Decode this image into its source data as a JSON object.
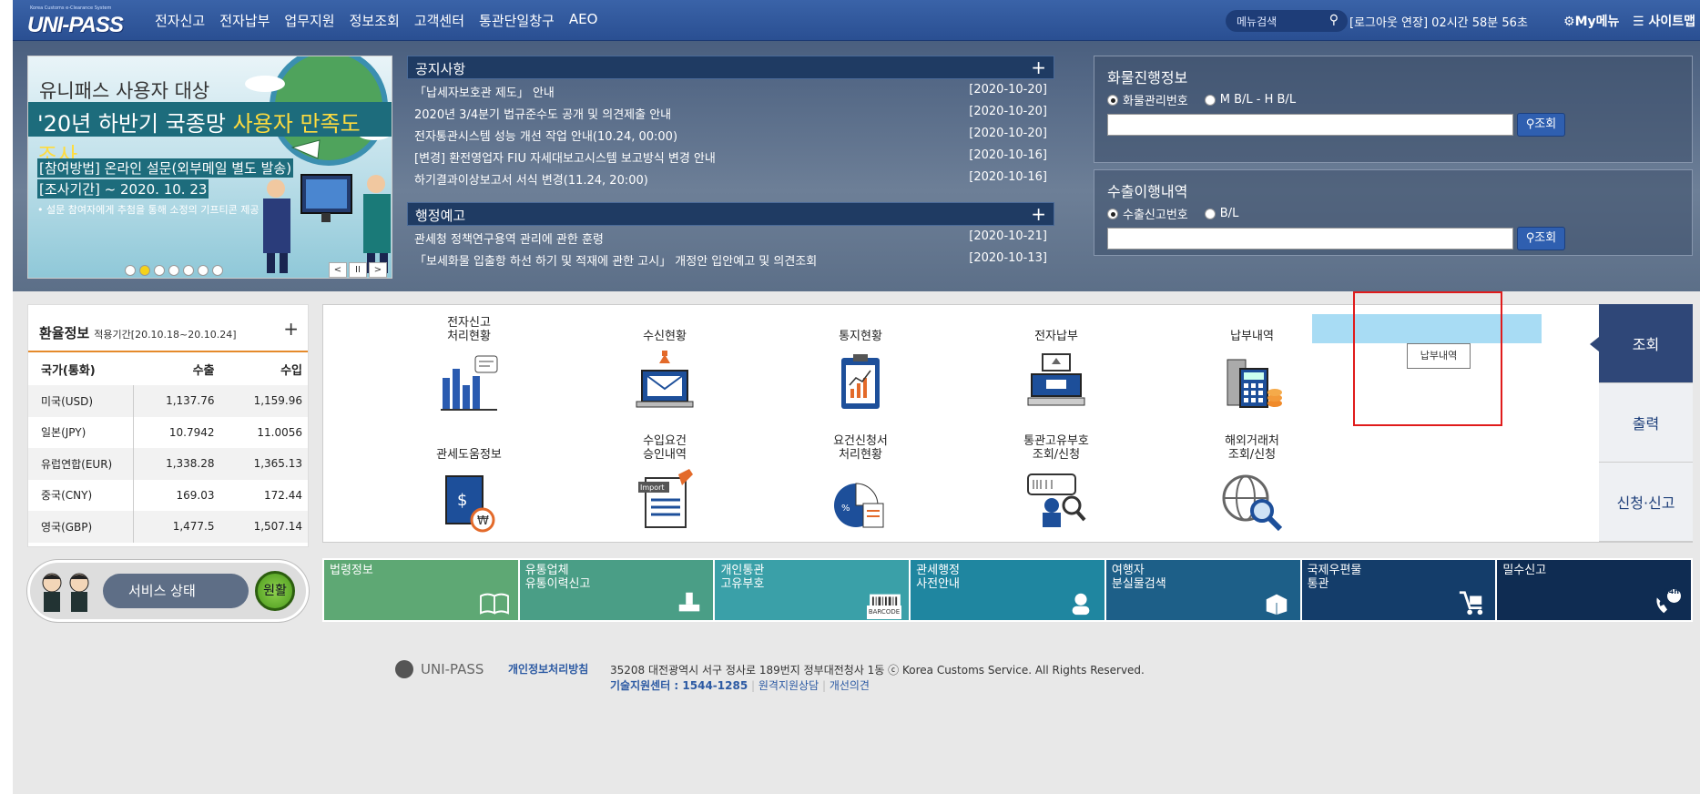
{
  "brand": {
    "logo_small": "Korea Customs e-Clearance System",
    "logo_text": "UNI-PASS"
  },
  "gnb": [
    "전자신고",
    "전자납부",
    "업무지원",
    "정보조회",
    "고객센터",
    "통관단일창구",
    "AEO"
  ],
  "search": {
    "placeholder": "메뉴검색"
  },
  "session": {
    "text": "[로그아웃 연장] 02시간 58분 56초"
  },
  "my_menu": "My메뉴",
  "sitemap": "사이트맵",
  "banner": {
    "line1": "유니패스 사용자 대상",
    "line2_a": "'20년 하반기 국종망 ",
    "line2_b": "사용자 만족도 조사",
    "method": "[참여방법]  온라인 설문(외부메일 별도 발송)",
    "period": "[조사기간]  ~ 2020. 10. 23",
    "note": "• 설문 참여자에게 추첨을 통해 소정의 기프티콘 제공",
    "slide_count": 7,
    "active_slide": 2
  },
  "notice": {
    "title": "공지사항",
    "items": [
      {
        "title": "「납세자보호관 제도」 안내",
        "date": "[2020-10-20]"
      },
      {
        "title": "2020년 3/4분기 법규준수도 공개 및 의견제출 안내",
        "date": "[2020-10-20]"
      },
      {
        "title": "전자통관시스템 성능 개선 작업 안내(10.24, 00:00)",
        "date": "[2020-10-20]"
      },
      {
        "title": "[변경] 환전영업자 FIU 자세대보고시스템 보고방식 변경 안내",
        "date": "[2020-10-16]"
      },
      {
        "title": "하기결과이상보고서 서식 변경(11.24, 20:00)",
        "date": "[2020-10-16]"
      }
    ]
  },
  "admin_notice": {
    "title": "행정예고",
    "items": [
      {
        "title": "관세청 정책연구용역 관리에 관한 훈령",
        "date": "[2020-10-21]"
      },
      {
        "title": "「보세화물 입출항 하선 하기 및 적재에 관한 고시」 개정안 입안예고 및 의견조회",
        "date": "[2020-10-13]"
      }
    ]
  },
  "cargo": {
    "title": "화물진행정보",
    "radio1": "화물관리번호",
    "radio2": "M B/L - H B/L",
    "button": "조회"
  },
  "export": {
    "title": "수출이행내역",
    "radio1": "수출신고번호",
    "radio2": "B/L",
    "button": "조회"
  },
  "exchange": {
    "title": "환율정보",
    "period": "적용기간[20.10.18~20.10.24]",
    "headers": [
      "국가(통화)",
      "수출",
      "수입"
    ],
    "rows": [
      [
        "미국(USD)",
        "1,137.76",
        "1,159.96"
      ],
      [
        "일본(JPY)",
        "10.7942",
        "11.0056"
      ],
      [
        "유럽연합(EUR)",
        "1,338.28",
        "1,365.13"
      ],
      [
        "중국(CNY)",
        "169.03",
        "172.44"
      ],
      [
        "영국(GBP)",
        "1,477.5",
        "1,507.14"
      ]
    ]
  },
  "service": {
    "label": "서비스 상태",
    "status": "원활"
  },
  "menu_grid": [
    {
      "label": "전자신고\n처리현황",
      "icon": "bar-chart-icon"
    },
    {
      "label": "수신현황",
      "icon": "mail-laptop-icon"
    },
    {
      "label": "통지현황",
      "icon": "clipboard-chart-icon"
    },
    {
      "label": "전자납부",
      "icon": "payment-terminal-icon"
    },
    {
      "label": "납부내역",
      "icon": "calculator-coins-icon"
    },
    {
      "label": "관세도움정보",
      "icon": "book-won-icon"
    },
    {
      "label": "수입요건\n승인내역",
      "icon": "import-document-icon"
    },
    {
      "label": "요건신청서\n처리현황",
      "icon": "pie-document-icon"
    },
    {
      "label": "통관고유부호\n조회/신청",
      "icon": "person-search-icon"
    },
    {
      "label": "해외거래처\n조회/신청",
      "icon": "globe-search-icon"
    }
  ],
  "tooltip": "납부내역",
  "side_tabs": [
    "조회",
    "출력",
    "신청·신고"
  ],
  "quick_links": [
    {
      "label": "법령정보",
      "color": "#5ea874",
      "icon": "book-icon"
    },
    {
      "label": "유통업체\n유통이력신고",
      "color": "#4a9e86",
      "icon": "stamp-icon"
    },
    {
      "label": "개인통관\n고유부호",
      "color": "#3aa0a8",
      "icon": "barcode-icon"
    },
    {
      "label": "관세행정\n사전안내",
      "color": "#1f86a0",
      "icon": "headset-icon"
    },
    {
      "label": "여행자\n분실물검색",
      "color": "#1d5f88",
      "icon": "box-icon"
    },
    {
      "label": "국제우편물\n통관",
      "color": "#143d6a",
      "icon": "cart-icon"
    },
    {
      "label": "밀수신고",
      "color": "#0f2c52",
      "icon": "phone-24h-icon"
    }
  ],
  "barcode_text": "BARCODE",
  "badge_24h": "24h",
  "footer": {
    "logo": "UNI-PASS",
    "privacy": "개인정보처리방침",
    "address": "35208 대전광역시 서구 정사로 189번지 정부대전청사 1동  ⓒ Korea Customs Service. All Rights Reserved.",
    "support_label": "기술지원센터 : ",
    "support_phone": "1544-1285",
    "remote": "원격지원상담",
    "feedback": "개선의견"
  }
}
